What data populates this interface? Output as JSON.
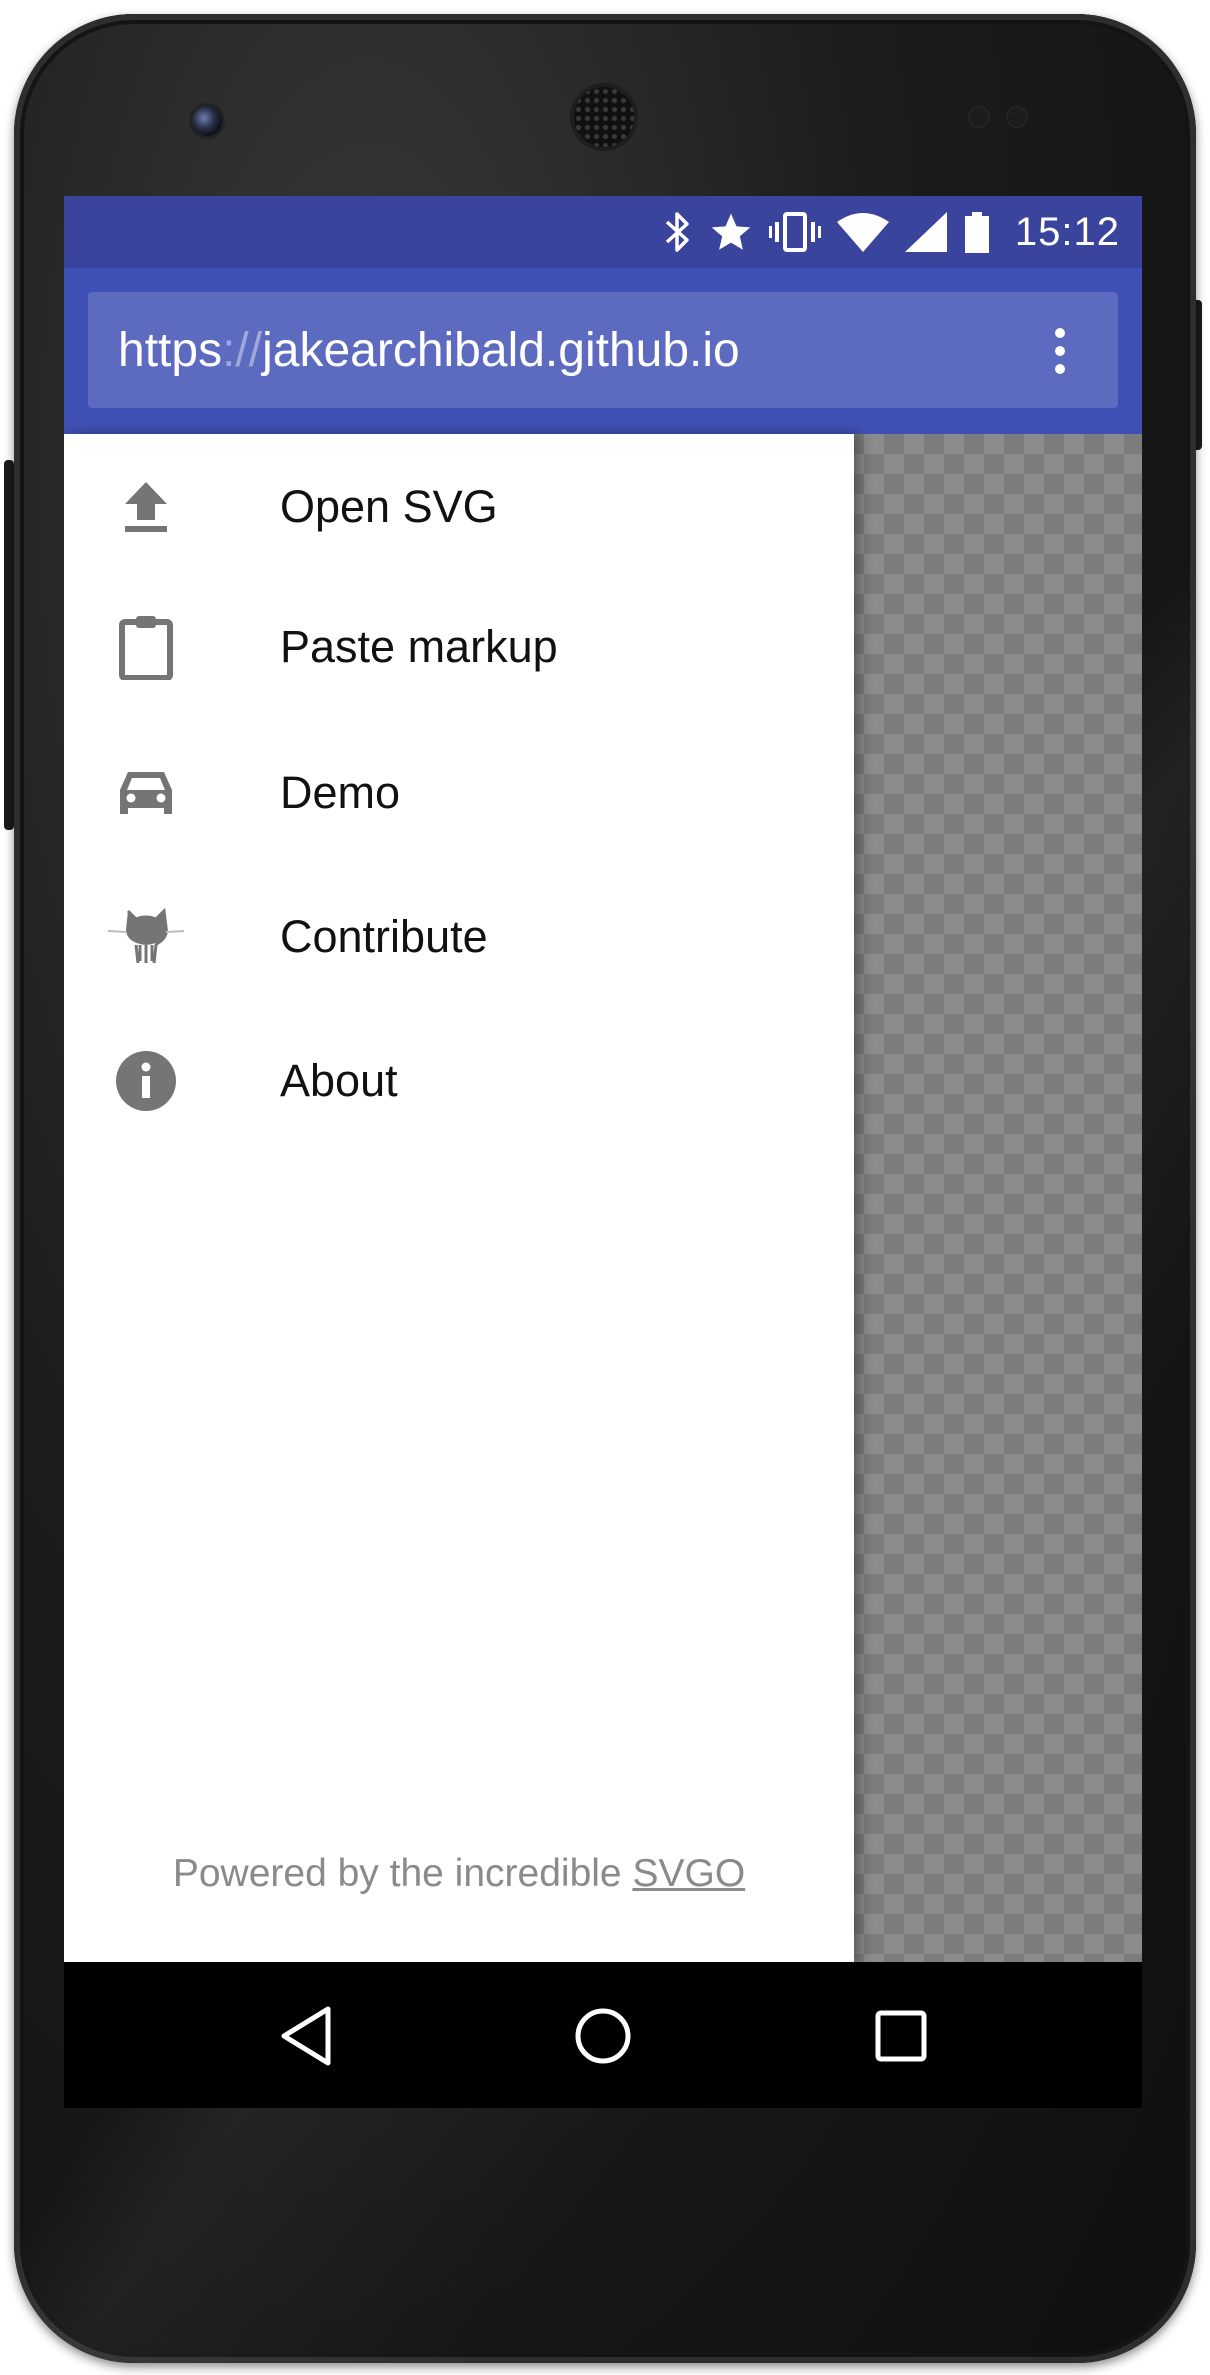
{
  "status_bar": {
    "time": "15:12",
    "icons": [
      "bluetooth-icon",
      "star-icon",
      "vibrate-icon",
      "wifi-icon",
      "cell-signal-icon",
      "battery-icon"
    ]
  },
  "address_bar": {
    "url_scheme": "https",
    "url_separator": "://",
    "url_host": "jakearchibald.github.io",
    "menu_icon": "overflow-menu-icon"
  },
  "drawer": {
    "items": [
      {
        "label": "Open SVG",
        "icon": "upload-icon"
      },
      {
        "label": "Paste markup",
        "icon": "clipboard-icon"
      },
      {
        "label": "Demo",
        "icon": "car-icon"
      },
      {
        "label": "Contribute",
        "icon": "github-octocat-icon"
      },
      {
        "label": "About",
        "icon": "info-icon"
      }
    ],
    "footer_text": "Powered by the incredible ",
    "footer_link": "SVGO"
  },
  "nav_bar": {
    "back_icon": "back-triangle-icon",
    "home_icon": "home-circle-icon",
    "recents_icon": "recents-square-icon"
  },
  "colors": {
    "status_bar": "#3a449d",
    "app_bar": "#3f51b5",
    "url_box": "#5c6bc0",
    "icon_gray": "#757575"
  }
}
